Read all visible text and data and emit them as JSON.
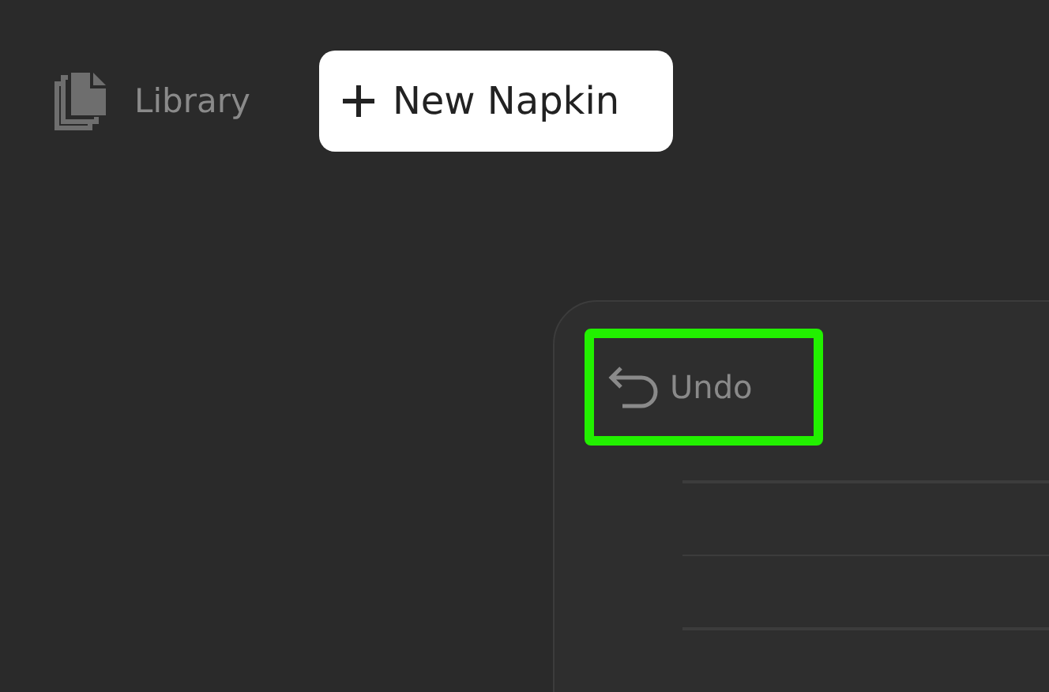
{
  "toolbar": {
    "library": {
      "label": "Library"
    },
    "new_button": {
      "label": "New Napkin"
    }
  },
  "panel": {
    "undo": {
      "label": "Undo",
      "highlighted": true
    }
  }
}
